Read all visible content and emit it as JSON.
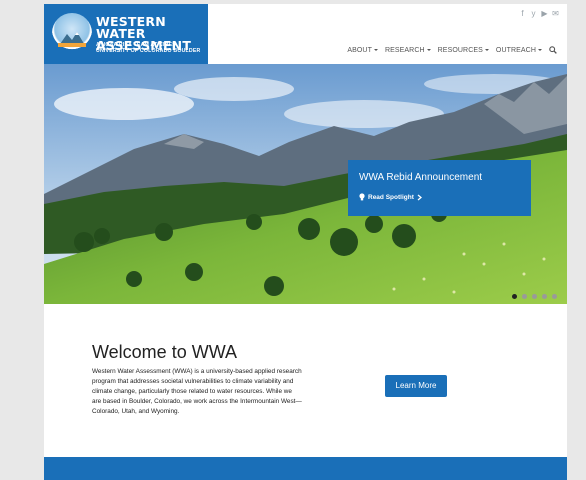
{
  "header": {
    "logo_title_line1": "WESTERN WATER",
    "logo_title_line2": "ASSESSMENT",
    "logo_sub_line1": "A NOAA RISA TEAM AT CIRES",
    "logo_sub_line2": "UNIVERSITY OF COLORADO BOULDER",
    "social": [
      "f",
      "y",
      "▶",
      "✉"
    ],
    "nav": [
      "ABOUT",
      "RESEARCH",
      "RESOURCES",
      "OUTREACH"
    ]
  },
  "hero": {
    "spotlight_title": "WWA Rebid Announcement",
    "spotlight_link": "Read Spotlight",
    "slide_count": 5,
    "active_slide": 1
  },
  "welcome": {
    "title": "Welcome to WWA",
    "body": "Western Water Assessment (WWA) is a university-based applied research program that addresses societal vulnerabilities to climate variability and climate change, particularly those related to water resources. While we are based in Boulder, Colorado, we work across the Intermountain West—Colorado, Utah, and Wyoming.",
    "button": "Learn More"
  },
  "colors": {
    "brand_blue": "#1a6fb8"
  }
}
